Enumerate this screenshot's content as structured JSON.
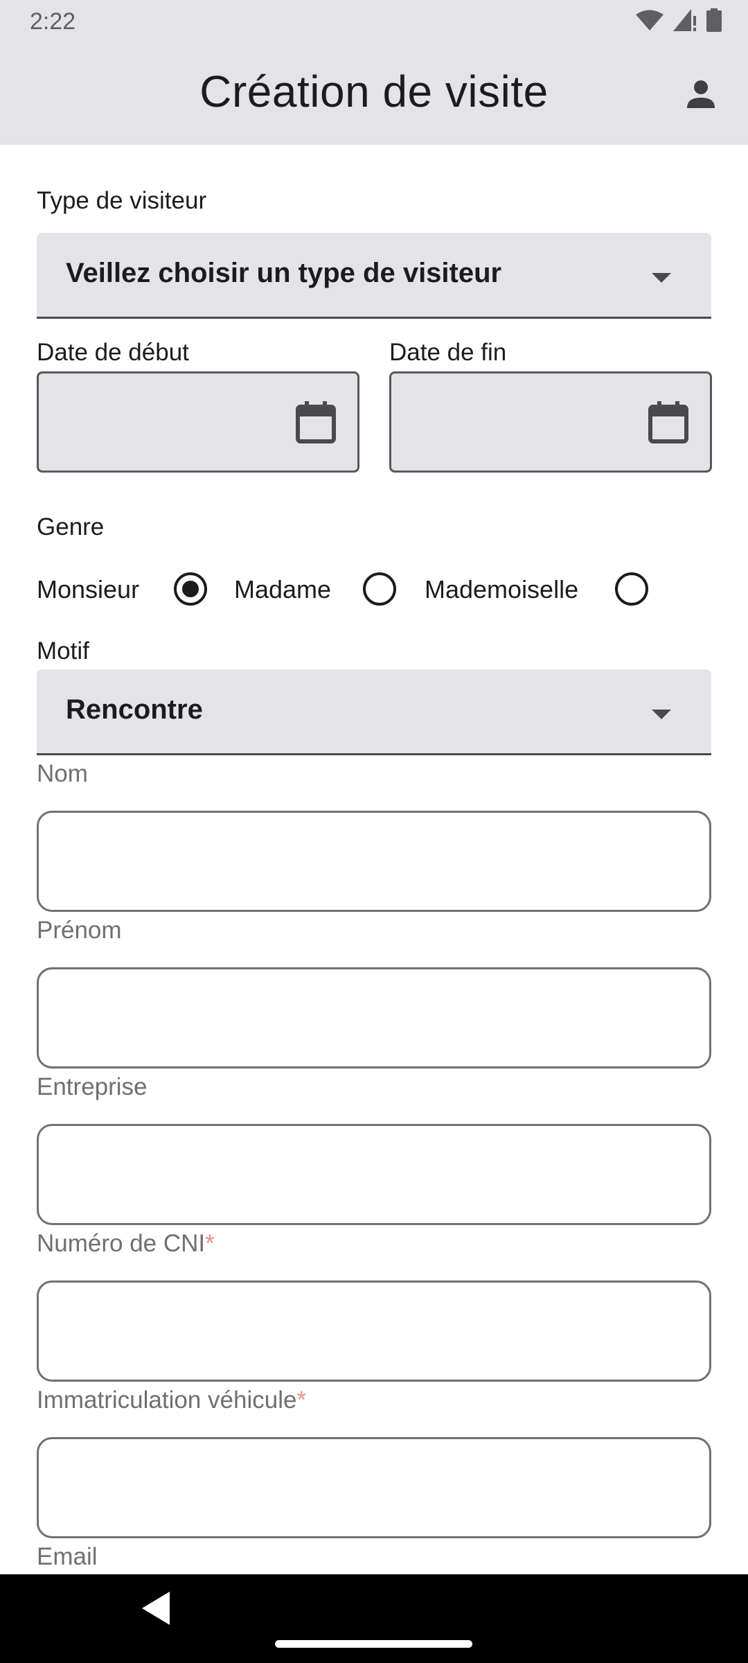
{
  "status_bar": {
    "time": "2:22"
  },
  "app_bar": {
    "title": "Création de visite"
  },
  "form": {
    "visitor_type": {
      "label": "Type de visiteur",
      "value": "Veillez choisir un type de visiteur"
    },
    "start_date": {
      "label": "Date de début",
      "value": ""
    },
    "end_date": {
      "label": "Date de fin",
      "value": ""
    },
    "gender": {
      "label": "Genre",
      "options": [
        "Monsieur",
        "Madame",
        "Mademoiselle"
      ],
      "selected": "Monsieur"
    },
    "reason": {
      "label": "Motif",
      "value": "Rencontre"
    },
    "last_name": {
      "label": "Nom",
      "value": ""
    },
    "first_name": {
      "label": "Prénom",
      "value": ""
    },
    "company": {
      "label": "Entreprise",
      "value": ""
    },
    "id_number": {
      "label": "Numéro de CNI",
      "required_mark": "*",
      "value": ""
    },
    "vehicle_plate": {
      "label": "Immatriculation véhicule",
      "required_mark": "*",
      "value": ""
    },
    "email": {
      "label": "Email"
    }
  },
  "colors": {
    "app_bar_bg": "#e4e4e7",
    "field_bg": "#e4e4e7",
    "required": "#ef8c8c",
    "navbar": "#000000"
  },
  "icons": [
    "wifi-icon",
    "cellular-icon",
    "battery-icon",
    "person-icon",
    "calendar-icon",
    "back-icon"
  ]
}
